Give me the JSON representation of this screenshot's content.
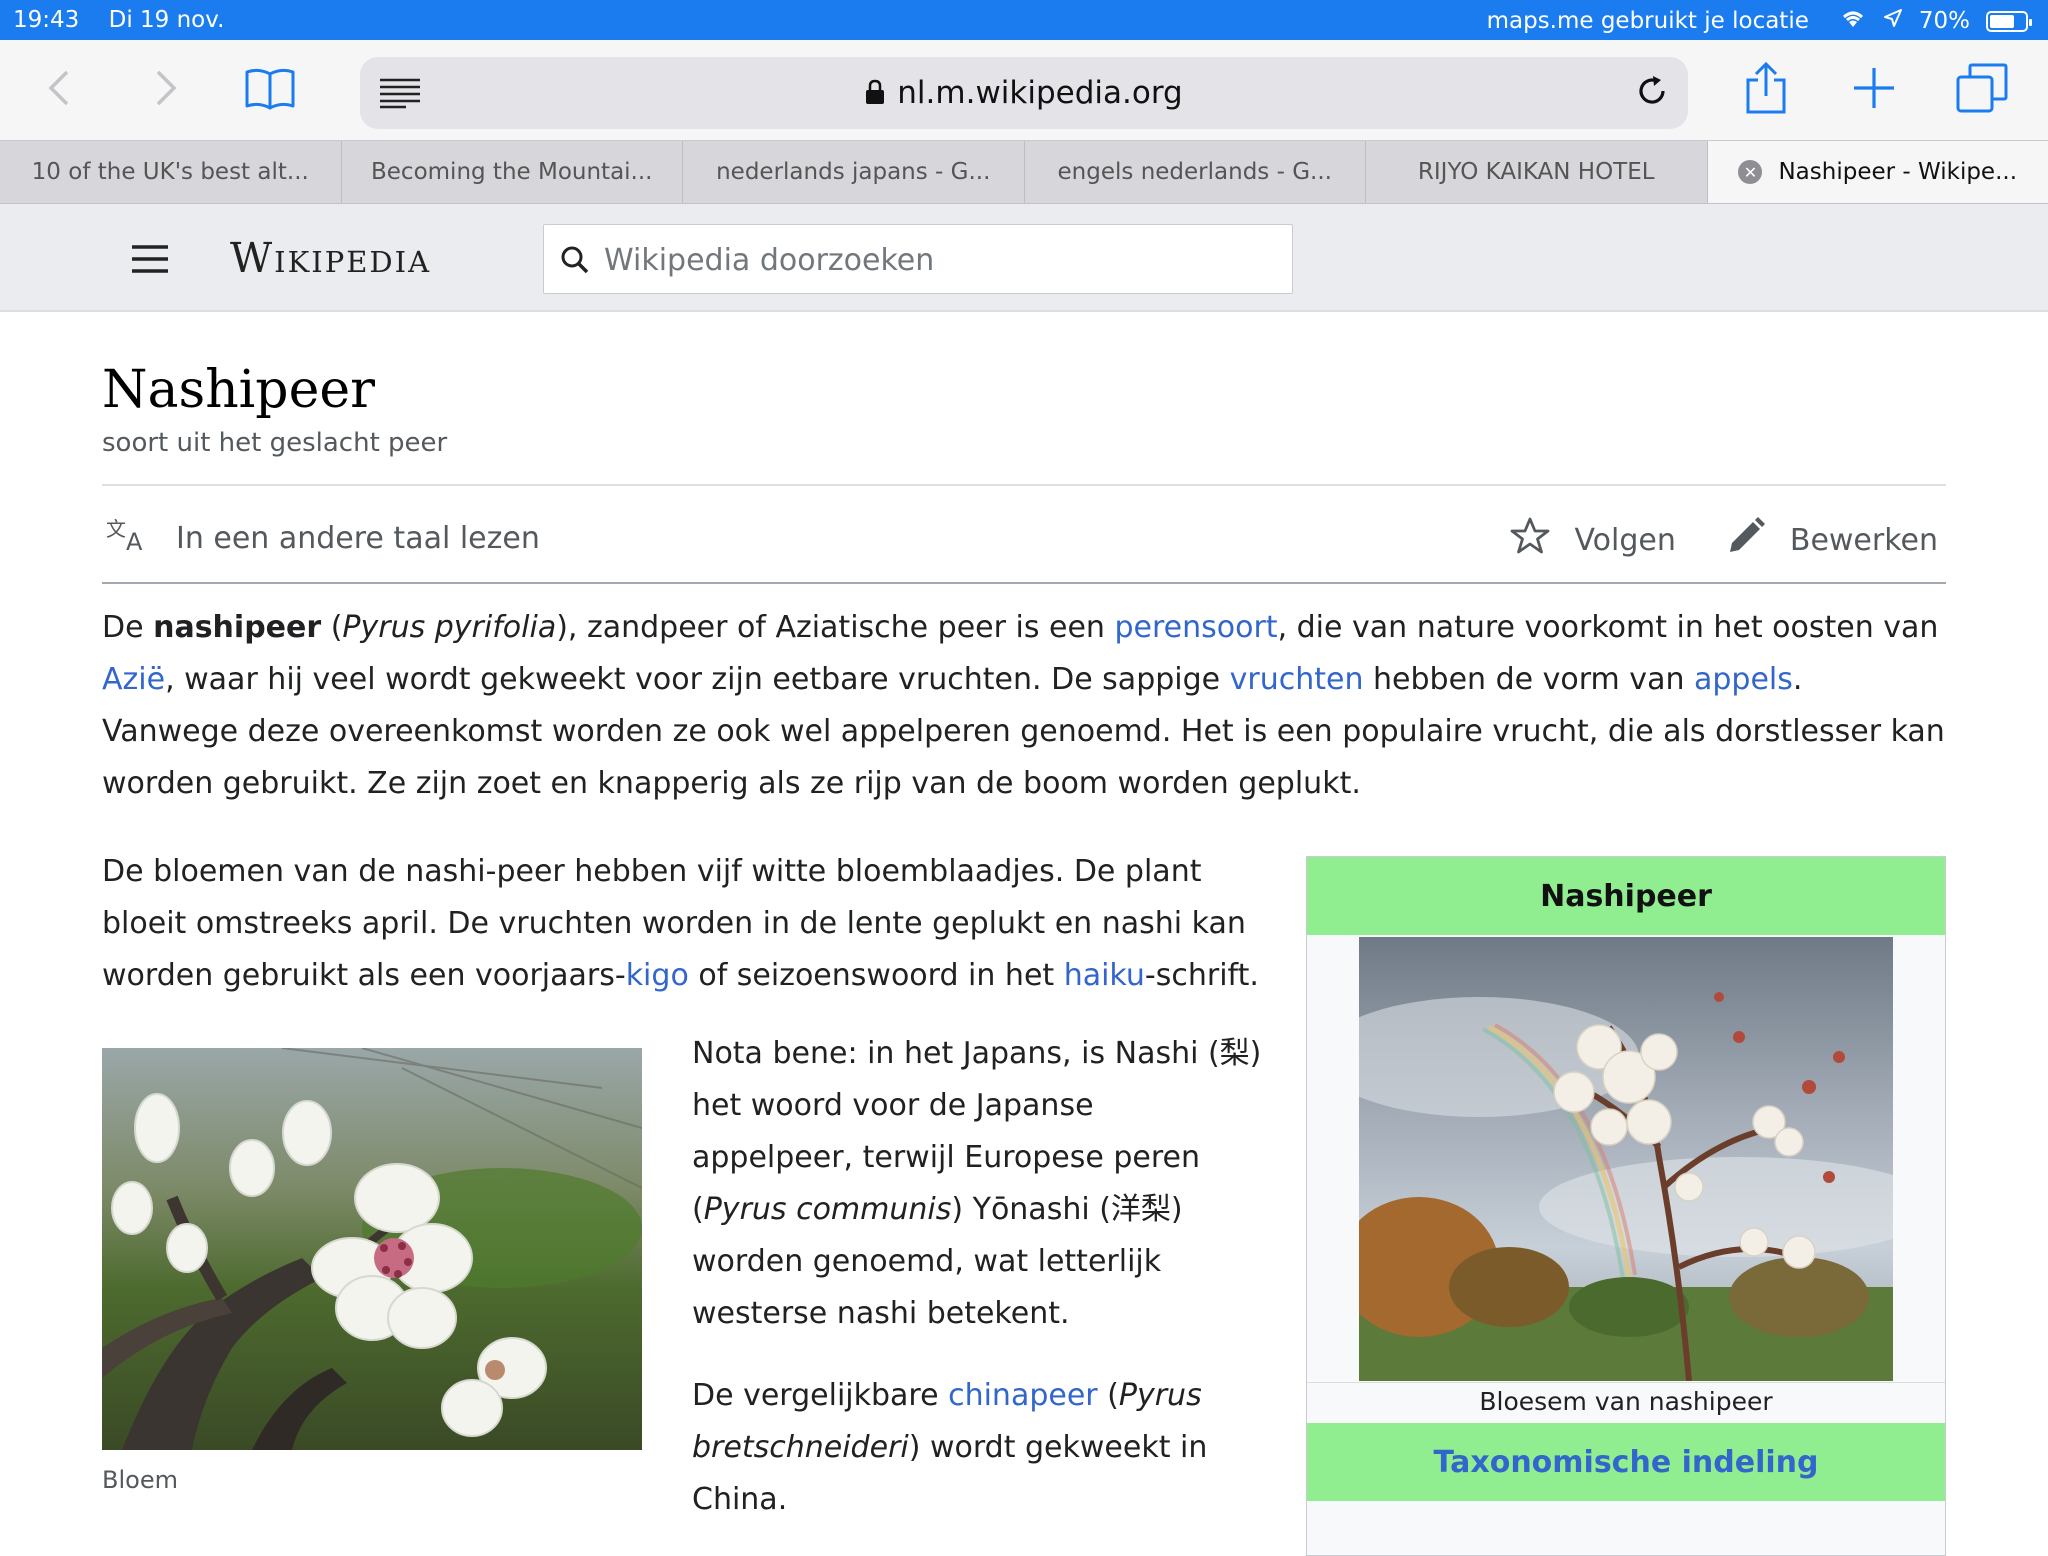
{
  "status": {
    "time": "19:43",
    "date": "Di 19 nov.",
    "location_text": "maps.me gebruikt je locatie",
    "battery": "70%",
    "battery_level": 0.7
  },
  "browser": {
    "url": "nl.m.wikipedia.org",
    "tabs": [
      {
        "label": "10 of the UK's best alt..."
      },
      {
        "label": "Becoming the Mountai..."
      },
      {
        "label": "nederlands japans - G..."
      },
      {
        "label": "engels nederlands - G..."
      },
      {
        "label": "RIJYO KAIKAN HOTEL"
      },
      {
        "label": "Nashipeer - Wikipe...",
        "active": true
      }
    ],
    "accent": "#1b7cf0"
  },
  "wiki": {
    "logo": "Wikipedia",
    "search_placeholder": "Wikipedia doorzoeken"
  },
  "article": {
    "title": "Nashipeer",
    "subtitle": "soort uit het geslacht peer",
    "actions": {
      "read_other_language": "In een andere taal lezen",
      "follow": "Volgen",
      "edit": "Bewerken"
    },
    "p1": {
      "s1": "De ",
      "bold": "nashipeer",
      "s2": " (",
      "italic": "Pyrus pyrifolia",
      "s3": "), zandpeer of Aziatische peer is een ",
      "link1": "perensoort",
      "s4": ", die van nature voorkomt in het oosten van ",
      "link2": "Azië",
      "s5": ", waar hij veel wordt gekweekt voor zijn eetbare vruchten. De sappige ",
      "link3": "vruchten",
      "s6": " hebben de vorm van ",
      "link4": "appels",
      "s7": ". Vanwege deze overeenkomst worden ze ook wel appelperen genoemd. Het is een populaire vrucht, die als dorstlesser kan worden gebruikt. Ze zijn zoet en knapperig als ze rijp van de boom worden geplukt."
    },
    "p2": {
      "s1": "De bloemen van de nashi-peer hebben vijf witte bloemblaadjes. De plant bloeit omstreeks april. De vruchten worden in de lente geplukt en nashi kan worden gebruikt als een voorjaars-",
      "link1": "kigo",
      "s2": " of seizoenswoord in het ",
      "link2": "haiku",
      "s3": "-schrift."
    },
    "p3": {
      "s1": "Nota bene: in het Japans, is Nashi (梨) het woord voor de Japanse appelpeer, terwijl Europese peren (",
      "italic": "Pyrus communis",
      "s2": ") Yōnashi (洋梨) worden genoemd, wat letterlijk westerse nashi betekent."
    },
    "p4": {
      "s1": "De vergelijkbare ",
      "link1": "chinapeer",
      "s2": " (",
      "italic": "Pyrus bretschneideri",
      "s3": ") wordt gekweekt in China."
    },
    "figure_caption": "Bloem",
    "infobox": {
      "title": "Nashipeer",
      "caption": "Bloesem van nashipeer",
      "taxonomy": "Taxonomische indeling",
      "header_color": "#90ee90"
    },
    "link_color": "#3366cc"
  }
}
